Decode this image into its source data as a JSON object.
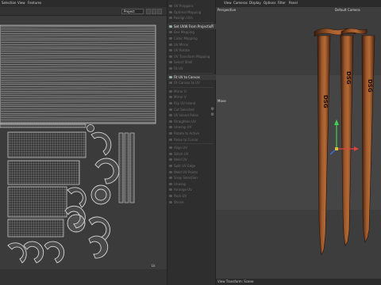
{
  "uv_editor": {
    "menu": [
      "Selection",
      "View",
      "Features"
    ],
    "projection_value": "Project",
    "scroll_marker": "Lk"
  },
  "commands": [
    {
      "label": "UV Polygons",
      "bright": false
    },
    {
      "label": "Optimal Mapping",
      "bright": false
    },
    {
      "label": "Realign UVs",
      "bright": false
    },
    {
      "label": "Set UVW From Projection",
      "bright": true,
      "gear": true
    },
    {
      "label": "Box Mapping",
      "bright": false
    },
    {
      "label": "Cubic Mapping",
      "bright": false
    },
    {
      "label": "UV Mirror",
      "bright": false
    },
    {
      "label": "UV Rotate",
      "bright": false
    },
    {
      "label": "UV Transform Mapping",
      "bright": false
    },
    {
      "label": "Select Shell",
      "bright": false
    },
    {
      "label": "Fit UV",
      "bright": false
    },
    {
      "label": "Fit UV to Canvas",
      "bright": true
    },
    {
      "label": "Fit Canvas to UV",
      "bright": false
    },
    {
      "label": "Mirror U",
      "bright": false
    },
    {
      "label": "Mirror V",
      "bright": false
    },
    {
      "label": "Flip UV Island",
      "bright": false
    },
    {
      "label": "Cut Selected",
      "bright": false,
      "gear": true
    },
    {
      "label": "UV Island Relax",
      "bright": false,
      "gear": true
    },
    {
      "label": "Straighten UV",
      "bright": false
    },
    {
      "label": "Unwrap UV",
      "bright": false
    },
    {
      "label": "Rotate to Active",
      "bright": false
    },
    {
      "label": "Relax to Cursor",
      "bright": false
    },
    {
      "label": "Align UV",
      "bright": false
    },
    {
      "label": "Stitch UV",
      "bright": false
    },
    {
      "label": "Weld UV",
      "bright": false
    },
    {
      "label": "Split UV Edge",
      "bright": false
    },
    {
      "label": "Weld UV Points",
      "bright": false
    },
    {
      "label": "Snap Selection",
      "bright": false
    },
    {
      "label": "Unwrap",
      "bright": false
    },
    {
      "label": "Arrange UV",
      "bright": false
    },
    {
      "label": "Pack UV",
      "bright": false
    },
    {
      "label": "Shrink",
      "bright": false
    }
  ],
  "viewport": {
    "menu": [
      "View",
      "Cameras",
      "Display",
      "Options",
      "Filter",
      "Panel"
    ],
    "projection": "Perspective",
    "camera": "Default Camera",
    "axis_label": "Move",
    "status": "View Transform: Scene"
  },
  "model": {
    "brand_text": "DSG",
    "wood_color": "#8a4a22",
    "wood_dark": "#3a1c0e",
    "wood_light": "#b46a36"
  },
  "colors": {
    "axis_x": "#e04040",
    "axis_y": "#3fd050",
    "axis_z": "#3a6ef0",
    "uv_line": "#d6d6d6"
  }
}
